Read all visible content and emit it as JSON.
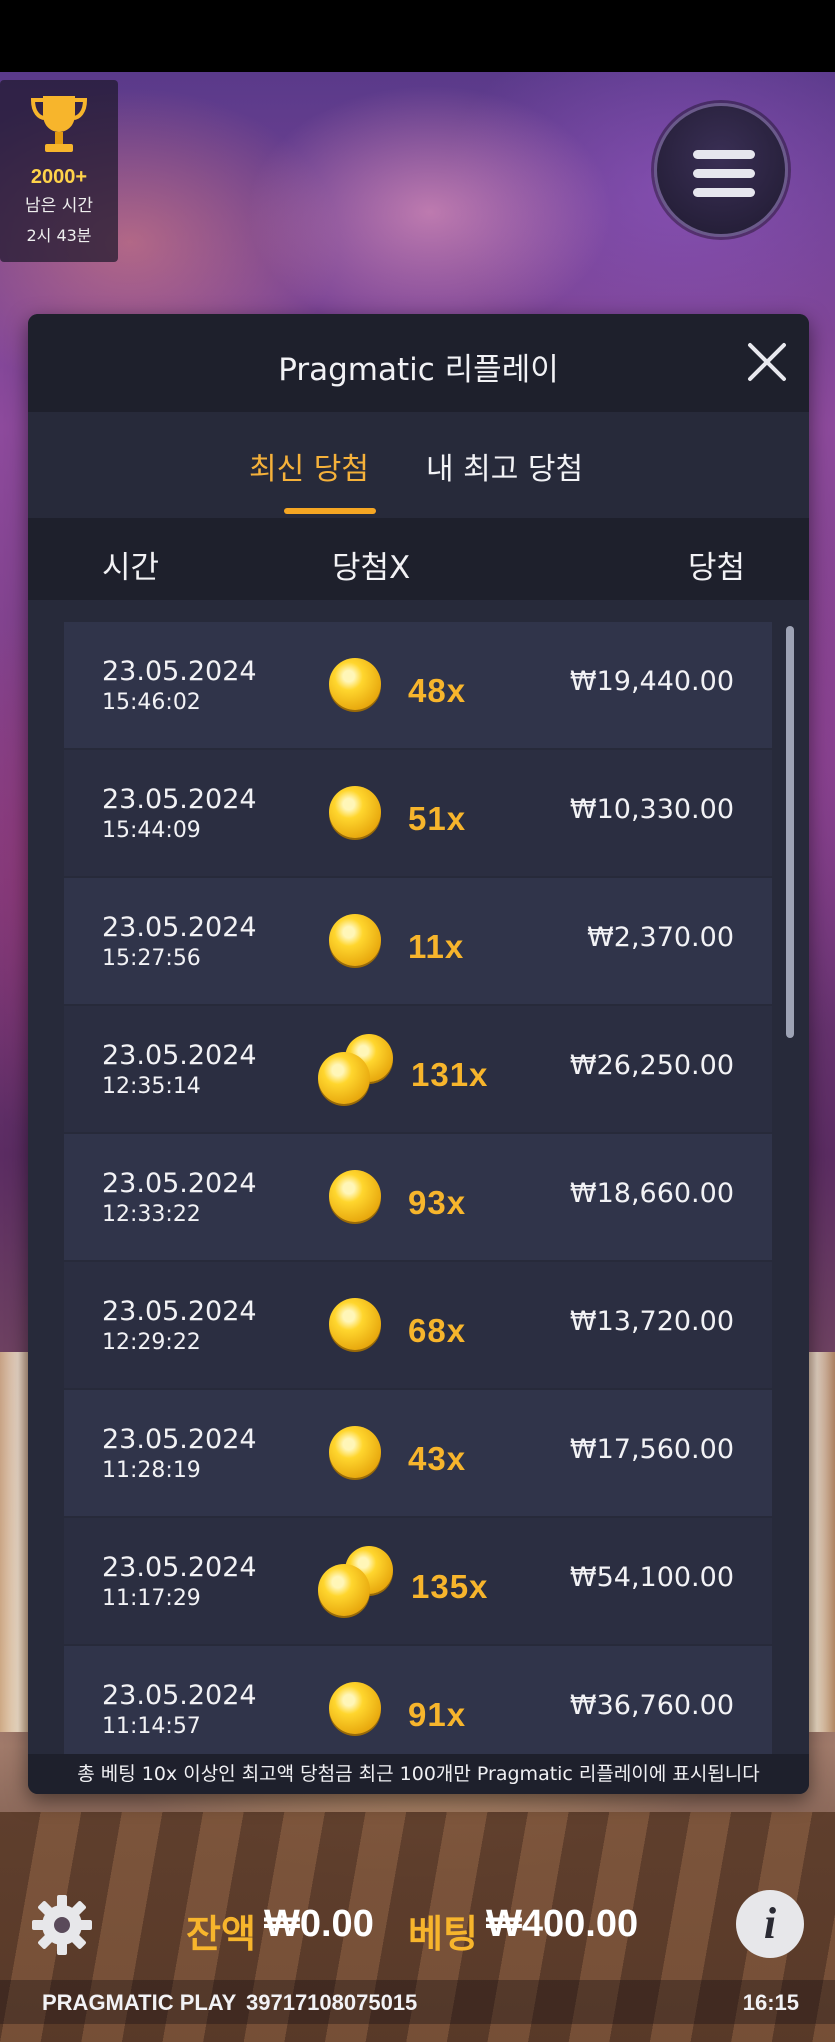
{
  "trophy": {
    "count": "2000+",
    "label": "남은 시간",
    "time": "2시 43분"
  },
  "modal": {
    "title": "Pragmatic 리플레이",
    "tabs": [
      {
        "label": "최신 당첨",
        "active": true
      },
      {
        "label": "내 최고 당첨",
        "active": false
      }
    ],
    "columns": {
      "time": "시간",
      "multiplier": "당첨X",
      "win": "당첨"
    },
    "rows": [
      {
        "date": "23.05.2024",
        "time": "15:46:02",
        "multiplier": "48x",
        "amount": "₩19,440.00",
        "coins": "single"
      },
      {
        "date": "23.05.2024",
        "time": "15:44:09",
        "multiplier": "51x",
        "amount": "₩10,330.00",
        "coins": "single"
      },
      {
        "date": "23.05.2024",
        "time": "15:27:56",
        "multiplier": "11x",
        "amount": "₩2,370.00",
        "coins": "single"
      },
      {
        "date": "23.05.2024",
        "time": "12:35:14",
        "multiplier": "131x",
        "amount": "₩26,250.00",
        "coins": "multi"
      },
      {
        "date": "23.05.2024",
        "time": "12:33:22",
        "multiplier": "93x",
        "amount": "₩18,660.00",
        "coins": "single"
      },
      {
        "date": "23.05.2024",
        "time": "12:29:22",
        "multiplier": "68x",
        "amount": "₩13,720.00",
        "coins": "single"
      },
      {
        "date": "23.05.2024",
        "time": "11:28:19",
        "multiplier": "43x",
        "amount": "₩17,560.00",
        "coins": "single"
      },
      {
        "date": "23.05.2024",
        "time": "11:17:29",
        "multiplier": "135x",
        "amount": "₩54,100.00",
        "coins": "multi"
      },
      {
        "date": "23.05.2024",
        "time": "11:14:57",
        "multiplier": "91x",
        "amount": "₩36,760.00",
        "coins": "single"
      }
    ],
    "footer": "총 베팅 10x 이상인 최고액 당첨금 최근 100개만 Pragmatic 리플레이에 표시됩니다"
  },
  "bottom": {
    "balance_label": "잔액",
    "balance_value": "₩0.00",
    "bet_label": "베팅",
    "bet_value": "₩400.00"
  },
  "status": {
    "brand": "PRAGMATIC PLAY",
    "id": "39717108075015",
    "clock": "16:15"
  },
  "colors": {
    "accent": "#f5a623",
    "panel": "#272a3a",
    "header": "#1e202c"
  },
  "icons": {
    "trophy": "trophy-icon",
    "menu": "hamburger-menu-icon",
    "close": "close-icon",
    "settings": "gear-icon",
    "info": "info-icon",
    "coin": "coin-icon"
  }
}
